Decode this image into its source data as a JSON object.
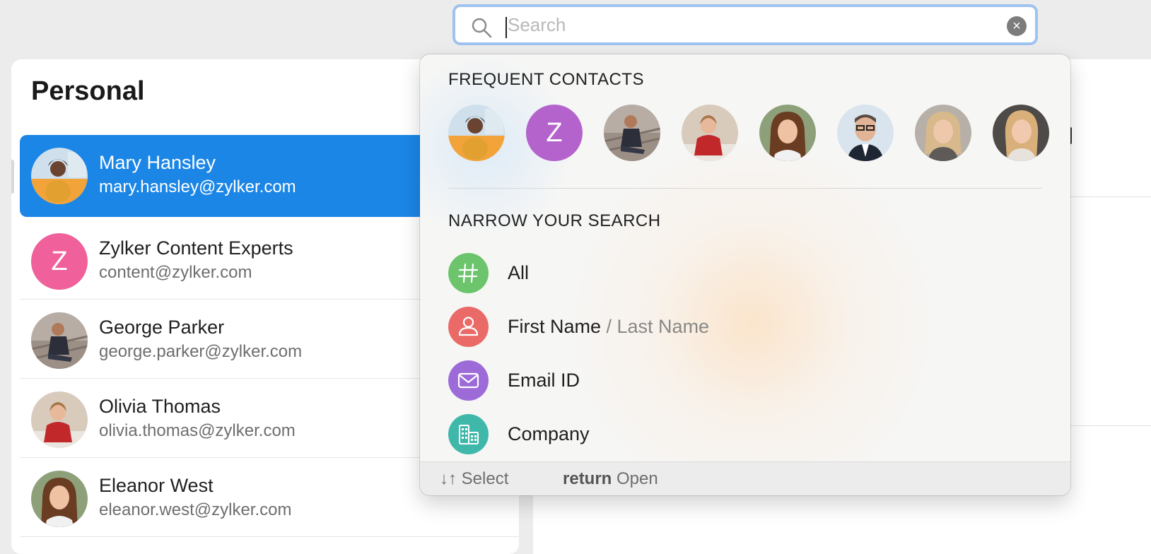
{
  "search": {
    "placeholder": "Search",
    "value": ""
  },
  "left_panel": {
    "title": "Personal",
    "contacts": [
      {
        "name": "Mary Hansley",
        "email": "mary.hansley@zylker.com",
        "selected": true
      },
      {
        "name": "Zylker Content Experts",
        "email": "content@zylker.com",
        "initial": "Z"
      },
      {
        "name": "George Parker",
        "email": "george.parker@zylker.com"
      },
      {
        "name": "Olivia Thomas",
        "email": "olivia.thomas@zylker.com"
      },
      {
        "name": "Eleanor West",
        "email": "eleanor.west@zylker.com"
      }
    ]
  },
  "dropdown": {
    "frequent_title": "FREQUENT CONTACTS",
    "frequent_contacts": [
      {
        "icon": "photo-avatar-icon"
      },
      {
        "initial": "Z"
      },
      {
        "icon": "photo-avatar-icon"
      },
      {
        "icon": "photo-avatar-icon"
      },
      {
        "icon": "photo-avatar-icon"
      },
      {
        "icon": "photo-avatar-icon"
      },
      {
        "icon": "photo-avatar-icon"
      },
      {
        "icon": "photo-avatar-icon"
      }
    ],
    "narrow_title": "NARROW YOUR SEARCH",
    "options": [
      {
        "label": "All",
        "icon": "hash-icon",
        "color": "#6cc46c"
      },
      {
        "label": "First Name",
        "sub": " / Last Name",
        "icon": "person-icon",
        "color": "#ea6a68"
      },
      {
        "label": "Email ID",
        "icon": "envelope-icon",
        "color": "#9c6bd8"
      },
      {
        "label": "Company",
        "icon": "building-icon",
        "color": "#3fb8a9"
      }
    ],
    "footer": {
      "select_arrows": "↓↑",
      "select_label": "Select",
      "open_key": "return",
      "open_label": "Open"
    }
  },
  "colors": {
    "selection": "#1b86e6",
    "search_focus_ring": "#9fc3ef",
    "zylker_avatar": "#f0609a",
    "z_frequent_avatar": "#b463cc"
  }
}
